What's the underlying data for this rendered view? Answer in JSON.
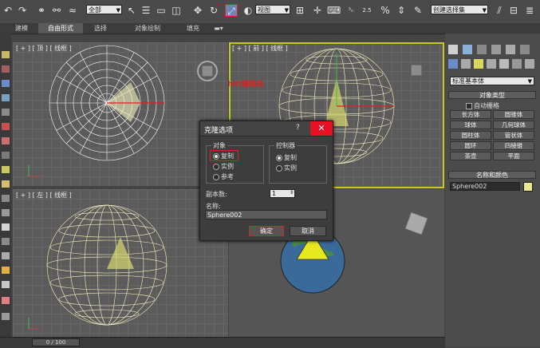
{
  "toolbar": {
    "selection_filter": "全部",
    "reference_coord": "视图",
    "named_selection": "创建选择集",
    "snap_angle_label": "2.5",
    "percent_snap_label": "%"
  },
  "ribbon_tabs": [
    {
      "label": "建模",
      "active": false
    },
    {
      "label": "自由形式",
      "active": true
    },
    {
      "label": "选择",
      "active": false
    },
    {
      "label": "对象绘制",
      "active": false
    },
    {
      "label": "填充",
      "active": false
    }
  ],
  "viewports": {
    "top": {
      "label": "[ + ] [ 顶 ] [ 线框 ]"
    },
    "front": {
      "label": "[ + ] [ 前 ] [ 线框 ]"
    },
    "left": {
      "label": "[ + ] [ 左 ] [ 线框 ]"
    },
    "persp": {
      "label": ""
    }
  },
  "annotation": "按住shift键拖动",
  "dialog": {
    "title": "克隆选项",
    "help": "?",
    "object_group": {
      "title": "对象",
      "options": [
        {
          "label": "复制",
          "selected": true
        },
        {
          "label": "实例",
          "selected": false
        },
        {
          "label": "参考",
          "selected": false
        }
      ]
    },
    "controller_group": {
      "title": "控制器",
      "options": [
        {
          "label": "复制",
          "selected": true
        },
        {
          "label": "实例",
          "selected": false
        }
      ]
    },
    "copies_label": "副本数:",
    "copies_value": "1",
    "name_label": "名称:",
    "name_value": "Sphere002",
    "ok_label": "确定",
    "cancel_label": "取消"
  },
  "command_panel": {
    "category": "标准基本体",
    "object_type_title": "对象类型",
    "autogrid_label": "自动栅格",
    "buttons": [
      "长方体",
      "圆锥体",
      "球体",
      "几何球体",
      "圆柱体",
      "管状体",
      "圆环",
      "四棱锥",
      "茶壶",
      "平面"
    ],
    "name_color_title": "名称和颜色",
    "object_name": "Sphere002",
    "object_color": "#e8e890"
  },
  "status_bar": {
    "frame_counter": "0 / 100"
  },
  "colors": {
    "accent_red": "#e02020",
    "wire_yellow": "#f4f4c0",
    "sphere_white": "#ffffff"
  }
}
